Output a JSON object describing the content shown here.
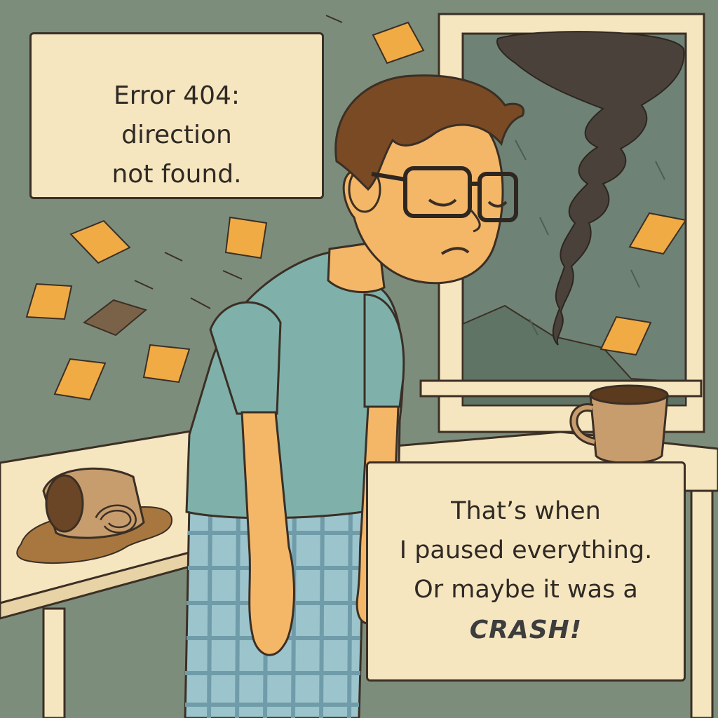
{
  "captions": {
    "top": {
      "lines": [
        "Error 404:",
        "direction",
        "not found."
      ]
    },
    "bottom": {
      "lines": [
        "That’s when",
        "I paused everything.",
        "Or maybe it was a"
      ],
      "emphasis": "CRASH!"
    }
  },
  "scene": {
    "elements": [
      "man-in-pajamas",
      "glasses",
      "tornado",
      "window",
      "flying-papers",
      "spilled-mug",
      "coffee-mug",
      "table"
    ]
  },
  "colors": {
    "wall": "#7d8d7c",
    "caption_bg": "#f6e6c0",
    "outline": "#3b2f25",
    "shirt": "#7fb1aa",
    "skin": "#f4b768",
    "hair": "#7a4a24",
    "paper": "#f0ab45",
    "coffee": "#7a5530",
    "mug": "#c89d6d"
  }
}
